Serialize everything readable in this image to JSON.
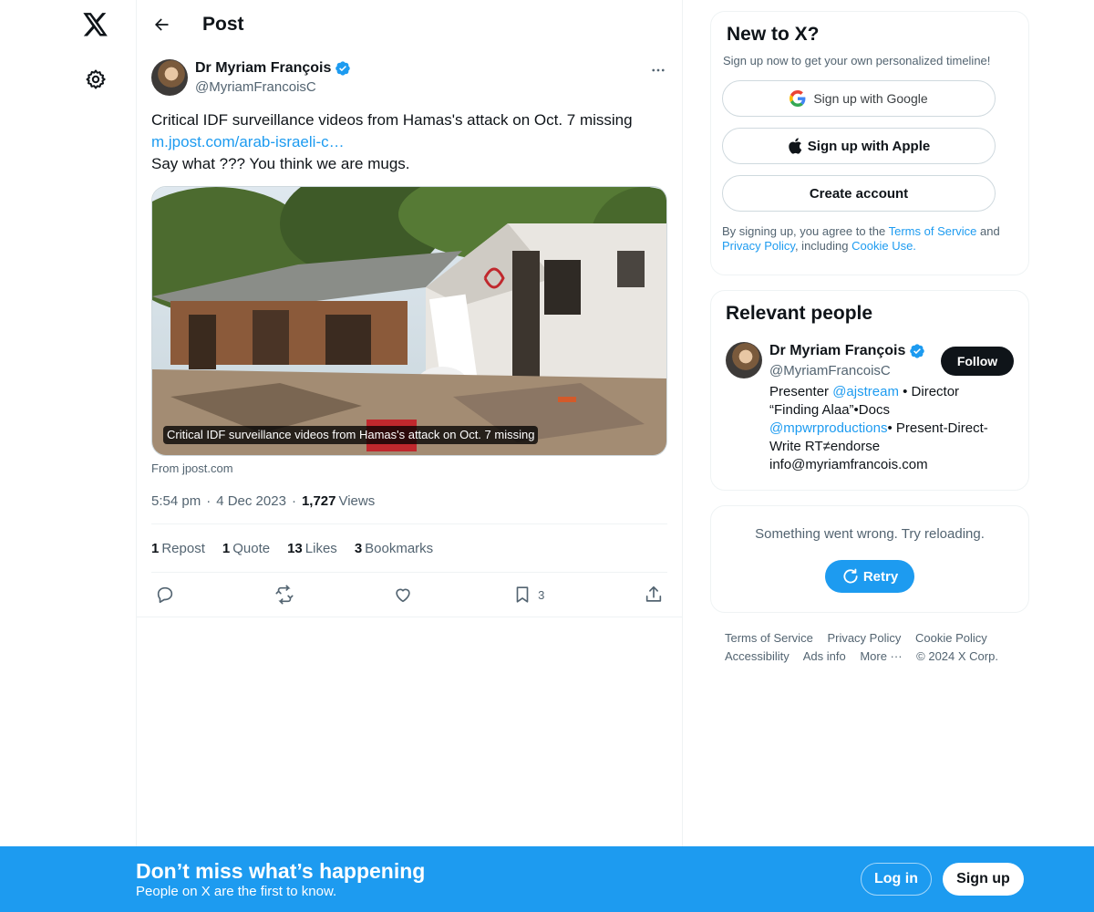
{
  "topbar": {
    "title": "Post"
  },
  "post": {
    "author_name": "Dr Myriam François",
    "author_handle": "@MyriamFrancoisC",
    "text_line1": "Critical IDF surveillance videos from Hamas's attack on Oct. 7 missing",
    "link_text": "m.jpost.com/arab-israeli-c…",
    "text_line3": "Say what ??? You think we are mugs.",
    "media_caption": "Critical IDF surveillance videos from Hamas's attack on Oct. 7 missing",
    "from_source": "From jpost.com",
    "time": "5:54 pm",
    "date": "4 Dec 2023",
    "views_count": "1,727",
    "views_label": "Views",
    "stats": {
      "reposts_count": "1",
      "reposts_label": "Repost",
      "quotes_count": "1",
      "quotes_label": "Quote",
      "likes_count": "13",
      "likes_label": "Likes",
      "bookmarks_count": "3",
      "bookmarks_label": "Bookmarks"
    },
    "bookmark_action_count": "3"
  },
  "signup": {
    "title": "New to X?",
    "subtitle": "Sign up now to get your own personalized timeline!",
    "google_label": "Sign up with Google",
    "apple_label": "Sign up with Apple",
    "create_label": "Create account",
    "terms_prefix": "By signing up, you agree to the ",
    "terms_link": "Terms of Service",
    "terms_and": " and ",
    "privacy_link": "Privacy Policy",
    "including": ", including ",
    "cookie_link": "Cookie Use."
  },
  "relevant": {
    "title": "Relevant people",
    "name": "Dr Myriam François",
    "handle": "@MyriamFrancoisC",
    "follow_label": "Follow",
    "bio_1": "Presenter ",
    "bio_mention1": "@ajstream",
    "bio_2": " • Director “Finding Alaa”•Docs ",
    "bio_mention2": "@mpwrproductions",
    "bio_3": "• Present-Direct-Write RT≠endorse info@myriamfrancois.com"
  },
  "error": {
    "message": "Something went wrong. Try reloading.",
    "retry_label": "Retry"
  },
  "footer": {
    "terms": "Terms of Service",
    "privacy": "Privacy Policy",
    "cookie": "Cookie Policy",
    "accessibility": "Accessibility",
    "ads": "Ads info",
    "more": "More ···",
    "copyright": "© 2024 X Corp."
  },
  "banner": {
    "title": "Don’t miss what’s happening",
    "subtitle": "People on X are the first to know.",
    "login_label": "Log in",
    "signup_label": "Sign up"
  },
  "colors": {
    "accent": "#1d9bf0",
    "text": "#0f1419",
    "muted": "#536471",
    "border": "#eff3f4"
  }
}
